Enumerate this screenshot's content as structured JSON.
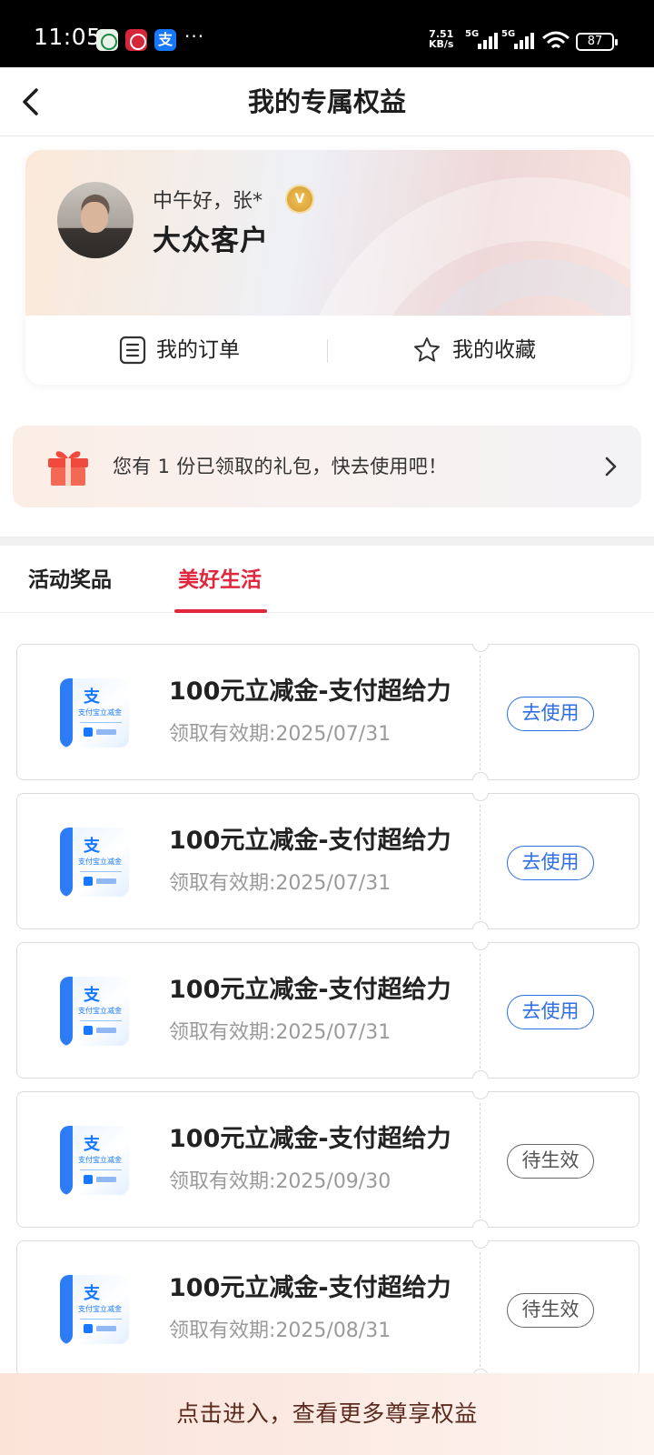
{
  "status_bar": {
    "time": "11:05",
    "network_speed_value": "7.51",
    "network_speed_unit": "KB/s",
    "signal_label_1": "5G",
    "signal_label_2": "5G",
    "battery": "87",
    "more_indicator": "···",
    "alipay_notification_glyph": "支"
  },
  "nav": {
    "title": "我的专属权益",
    "back_icon": "back-arrow-icon"
  },
  "profile": {
    "greeting": "中午好，张*",
    "vip_badge": "V",
    "level": "大众客户",
    "links": [
      {
        "label": "我的订单",
        "icon": "order-list-icon"
      },
      {
        "label": "我的收藏",
        "icon": "star-icon"
      }
    ]
  },
  "gift_banner": {
    "text": "您有 1 份已领取的礼包，快去使用吧！",
    "icon": "gift-icon",
    "arrow_icon": "chevron-right-icon"
  },
  "tabs": [
    {
      "label": "活动奖品",
      "active": false
    },
    {
      "label": "美好生活",
      "active": true
    }
  ],
  "coupons": [
    {
      "title": "100元立减金-支付超给力",
      "expiry": "领取有效期:2025/07/31",
      "action": "去使用",
      "state": "use",
      "thumb_glyph": "支",
      "thumb_text": "支付宝立减金"
    },
    {
      "title": "100元立减金-支付超给力",
      "expiry": "领取有效期:2025/07/31",
      "action": "去使用",
      "state": "use",
      "thumb_glyph": "支",
      "thumb_text": "支付宝立减金"
    },
    {
      "title": "100元立减金-支付超给力",
      "expiry": "领取有效期:2025/07/31",
      "action": "去使用",
      "state": "use",
      "thumb_glyph": "支",
      "thumb_text": "支付宝立减金"
    },
    {
      "title": "100元立减金-支付超给力",
      "expiry": "领取有效期:2025/09/30",
      "action": "待生效",
      "state": "pending",
      "thumb_glyph": "支",
      "thumb_text": "支付宝立减金"
    },
    {
      "title": "100元立减金-支付超给力",
      "expiry": "领取有效期:2025/08/31",
      "action": "待生效",
      "state": "pending",
      "thumb_glyph": "支",
      "thumb_text": "支付宝立减金"
    }
  ],
  "bottom_banner": {
    "text": "点击进入，查看更多尊享权益"
  },
  "colors": {
    "accent_red": "#e0273d",
    "use_button_blue": "#2f6fe3",
    "pending_gray": "#555555"
  }
}
